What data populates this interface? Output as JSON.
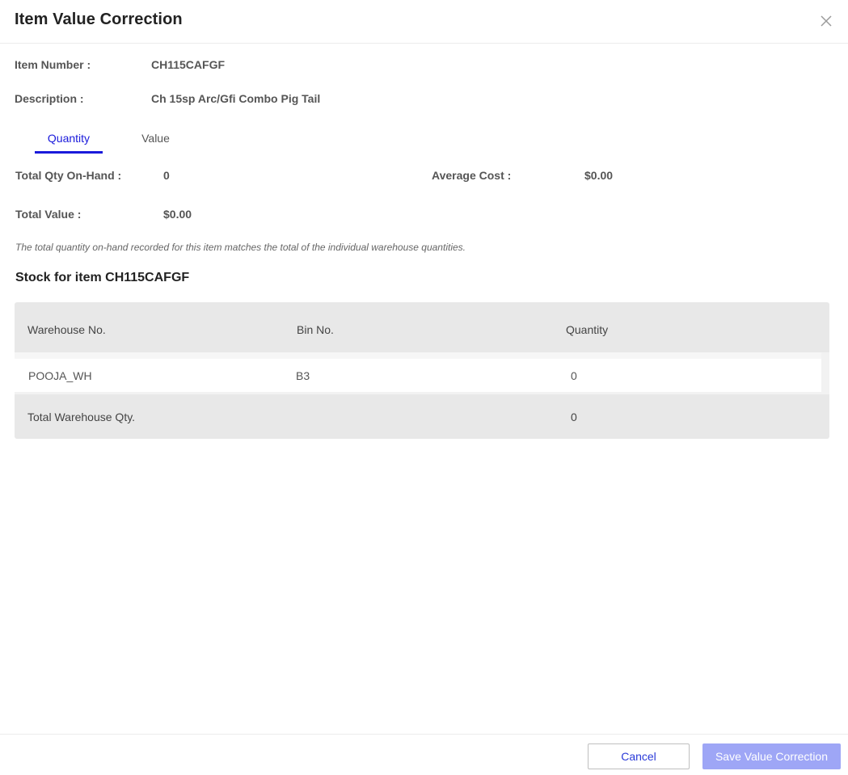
{
  "dialog": {
    "title": "Item Value Correction"
  },
  "item": {
    "number_label": "Item Number :",
    "number_value": "CH115CAFGF",
    "description_label": "Description :",
    "description_value": "Ch 15sp Arc/Gfi Combo Pig Tail"
  },
  "tabs": [
    {
      "label": "Quantity",
      "active": true
    },
    {
      "label": "Value",
      "active": false
    }
  ],
  "summary": {
    "total_qty_label": "Total Qty On-Hand :",
    "total_qty_value": "0",
    "average_cost_label": "Average Cost :",
    "average_cost_value": "$0.00",
    "total_value_label": "Total Value :",
    "total_value_value": "$0.00"
  },
  "note": "The total quantity on-hand recorded for this item matches the total of the individual warehouse quantities.",
  "stock": {
    "title": "Stock for item CH115CAFGF",
    "columns": [
      "Warehouse No.",
      "Bin No.",
      "Quantity"
    ],
    "rows": [
      {
        "warehouse": "POOJA_WH",
        "bin": "B3",
        "quantity": "0"
      }
    ],
    "total_label": "Total Warehouse Qty.",
    "total_value": "0"
  },
  "footer": {
    "cancel_label": "Cancel",
    "save_label": "Save Value Correction"
  },
  "colors": {
    "accent": "#1a1adb",
    "save_button": "#9ea6f6",
    "table_bg": "#e8e8e8"
  },
  "icons": {
    "close": "close-icon"
  }
}
